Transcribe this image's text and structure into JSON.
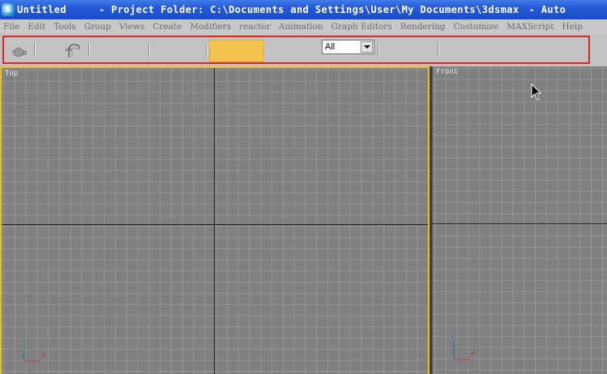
{
  "titlebar": {
    "app_icon_glyph": "S",
    "document_name": "Untitled",
    "project_text": "- Project Folder: C:\\Documents and Settings\\User\\My Documents\\3dsmax",
    "app_suffix": "- Auto"
  },
  "menubar": {
    "items": [
      "File",
      "Edit",
      "Tools",
      "Group",
      "Views",
      "Create",
      "Modifiers",
      "reactor",
      "Animation",
      "Graph Editors",
      "Rendering",
      "Customize",
      "MAXScript",
      "Help"
    ]
  },
  "toolbar": {
    "teapot_icon": "teapot-icon",
    "undo_icon": "undo-arrow-icon",
    "swatch_color": "#f4c34e",
    "selection_filter": {
      "value": "All"
    },
    "highlight_color": "#e02424"
  },
  "viewports": {
    "top": {
      "label": "Top",
      "active_border_color": "#e5c033"
    },
    "front": {
      "label": "Front"
    }
  },
  "gizmo": {
    "y": "y",
    "x": "x",
    "z": "z"
  }
}
